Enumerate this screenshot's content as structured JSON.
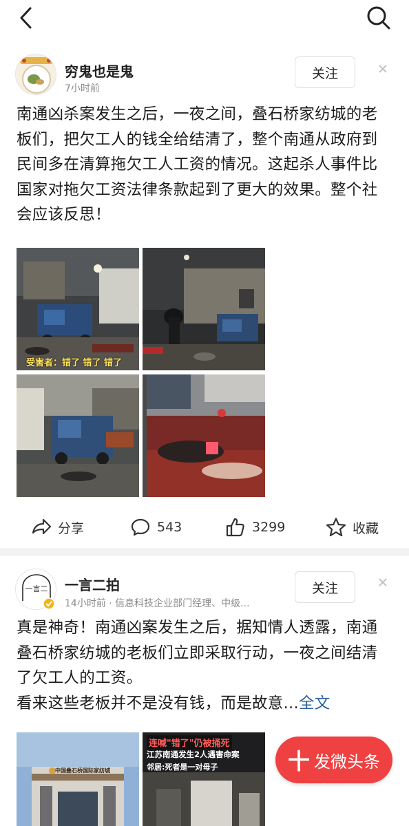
{
  "topbar": {
    "back_icon": "chevron-left-icon",
    "search_icon": "search-icon"
  },
  "posts": [
    {
      "author": "穷鬼也是鬼",
      "meta": "7小时前",
      "follow_label": "关注",
      "text": "南通凶杀案发生之后，一夜之间，叠石桥家纺城的老板们，把欠工人的钱全给结清了，整个南通从政府到民间多在清算拖欠工人工资的情况。这起杀人事件比国家对拖欠工资法律条款起到了更大的效果。整个社会应该反思！",
      "image_caption": "受害者：错了 错了 错了",
      "actions": {
        "share_label": "分享",
        "comments": "543",
        "likes": "3299",
        "favorite_label": "收藏"
      }
    },
    {
      "author": "一言二拍",
      "meta": "14小时前 · 信息科技企业部门经理、中级...",
      "follow_label": "关注",
      "avatar_text": "一言二",
      "text_line1": "真是神奇！南通凶案发生之后，据知情人透露，南通叠石桥家纺城的老板们立即采取行动，一夜之间结清了欠工人的工资。",
      "text_line2": "看来这些老板并不是没有钱，而是故意...",
      "fulltext_label": "全文",
      "image1_sign": "中国叠石桥国际家纺城",
      "image2_title1": "连喊\"错了\"仍被捅死",
      "image2_title2": "江苏南通发生2人遇害命案",
      "image2_title3": "邻居:死者是一对母子"
    }
  ],
  "fab": {
    "label": "发微头条",
    "plus": "十"
  }
}
